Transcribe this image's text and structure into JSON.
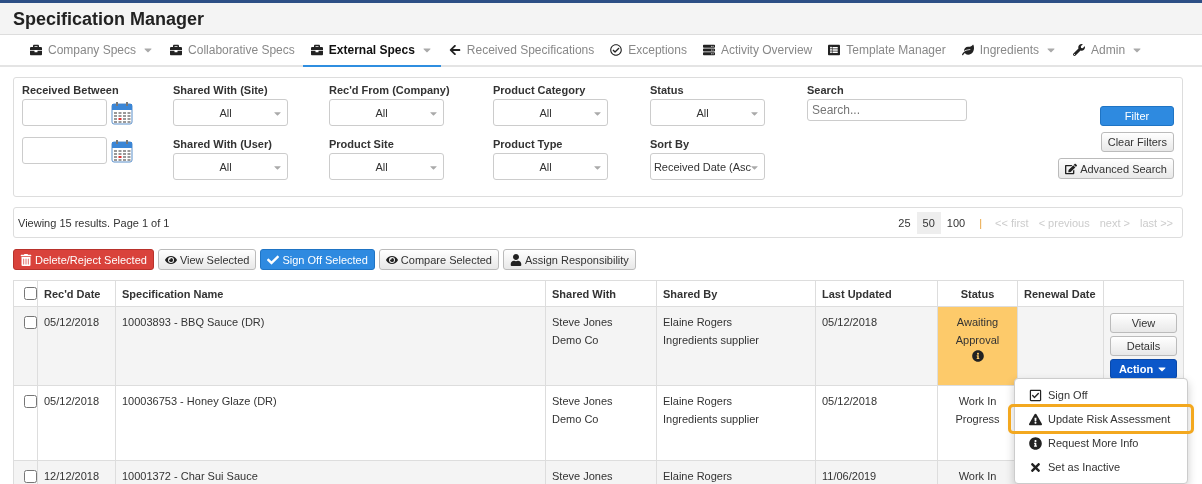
{
  "app_title": "Specification Manager",
  "nav": [
    {
      "label": "Company Specs",
      "dropdown": true,
      "selected": false
    },
    {
      "label": "Collaborative Specs",
      "dropdown": false,
      "selected": false
    },
    {
      "label": "External Specs",
      "dropdown": true,
      "selected": true
    },
    {
      "label": "Received Specifications",
      "dropdown": false,
      "selected": false
    },
    {
      "label": "Exceptions",
      "dropdown": false,
      "selected": false
    },
    {
      "label": "Activity Overview",
      "dropdown": false,
      "selected": false
    },
    {
      "label": "Template Manager",
      "dropdown": false,
      "selected": false
    },
    {
      "label": "Ingredients",
      "dropdown": true,
      "selected": false
    },
    {
      "label": "Admin",
      "dropdown": true,
      "selected": false
    }
  ],
  "filter_columns": [
    [
      {
        "label": "Received Between",
        "kind": "date_pair"
      }
    ],
    [
      {
        "label": "Shared With (Site)",
        "kind": "select",
        "value": "All"
      },
      {
        "label": "Shared With (User)",
        "kind": "select",
        "value": "All"
      }
    ],
    [
      {
        "label": "Rec'd From (Company)",
        "kind": "select",
        "value": "All"
      },
      {
        "label": "Product Site",
        "kind": "select",
        "value": "All"
      }
    ],
    [
      {
        "label": "Product Category",
        "kind": "select",
        "value": "All"
      },
      {
        "label": "Product Type",
        "kind": "select",
        "value": "All"
      }
    ],
    [
      {
        "label": "Status",
        "kind": "select",
        "value": "All"
      },
      {
        "label": "Sort By",
        "kind": "select",
        "value": "Received Date (Asc"
      }
    ],
    [
      {
        "label": "Search",
        "kind": "search",
        "placeholder": "Search..."
      }
    ]
  ],
  "filter_buttons": [
    {
      "label": "Filter",
      "kind": "primary"
    },
    {
      "label": "Clear Filters",
      "kind": "default"
    },
    {
      "label": "Advanced Search",
      "kind": "edit"
    }
  ],
  "results": {
    "summary": "Viewing 15 results. Page 1 of 1",
    "page_sizes": [
      {
        "label": "25",
        "selected": false
      },
      {
        "label": "50",
        "selected": true
      },
      {
        "label": "100",
        "selected": false
      }
    ],
    "separator": "|",
    "pager": [
      {
        "label": "<< first",
        "disabled": true
      },
      {
        "label": "< previous",
        "disabled": true
      },
      {
        "label": "next >",
        "disabled": true
      },
      {
        "label": "last >>",
        "disabled": true
      }
    ]
  },
  "bulk_actions": [
    {
      "label": "Delete/Reject Selected",
      "kind": "danger"
    },
    {
      "label": "View Selected",
      "kind": "default"
    },
    {
      "label": "Sign Off Selected",
      "kind": "primary"
    },
    {
      "label": "Compare Selected",
      "kind": "default"
    },
    {
      "label": "Assign Responsibility",
      "kind": "default"
    }
  ],
  "table": {
    "select_all_checked": false,
    "columns": [
      "Rec'd Date",
      "Specification Name",
      "Shared With",
      "Shared By",
      "Last Updated",
      "Status",
      "Renewal Date"
    ],
    "rows": [
      {
        "checked": false,
        "rec_date": "05/12/2018",
        "name": "10003893 - BBQ Sauce (DR)",
        "shared_with": [
          "Steve Jones",
          "Demo Co"
        ],
        "shared_by": [
          "Elaine Rogers",
          "Ingredients supplier"
        ],
        "last_updated": "05/12/2018",
        "status": "Awaiting Approval",
        "status_highlighted": true,
        "status_info": true,
        "actions": [
          {
            "label": "View",
            "kind": "default"
          },
          {
            "label": "Details",
            "kind": "default"
          },
          {
            "label": "Action",
            "kind": "dropdown"
          }
        ]
      },
      {
        "checked": false,
        "rec_date": "05/12/2018",
        "name": "100036753 - Honey Glaze (DR)",
        "shared_with": [
          "Steve Jones",
          "Demo Co"
        ],
        "shared_by": [
          "Elaine Rogers",
          "Ingredients supplier"
        ],
        "last_updated": "05/12/2018",
        "status": "Work In Progress",
        "status_highlighted": false,
        "actions": []
      },
      {
        "checked": false,
        "rec_date": "12/12/2018",
        "name": "10001372 - Char Sui Sauce",
        "shared_with": [
          "Steve Jones"
        ],
        "shared_by": [
          "Elaine Rogers"
        ],
        "last_updated": "11/06/2019",
        "status": "Work In",
        "status_highlighted": false,
        "actions": []
      }
    ]
  },
  "action_menu": [
    {
      "label": "Sign Off",
      "highlighted": false
    },
    {
      "label": "Update Risk Assessment",
      "highlighted": true
    },
    {
      "label": "Request More Info",
      "highlighted": false
    },
    {
      "label": "Set as Inactive",
      "highlighted": false
    }
  ]
}
